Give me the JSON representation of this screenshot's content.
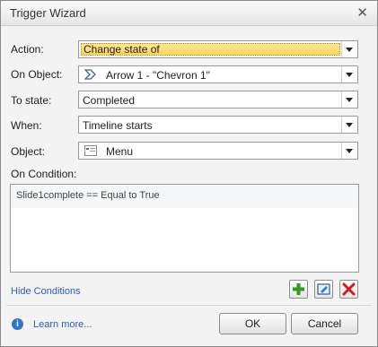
{
  "window": {
    "title": "Trigger Wizard"
  },
  "form": {
    "action": {
      "label": "Action:",
      "value": "Change state of"
    },
    "on_object": {
      "label": "On Object:",
      "value": "Arrow 1 - \"Chevron 1\""
    },
    "to_state": {
      "label": "To state:",
      "value": "Completed"
    },
    "when": {
      "label": "When:",
      "value": "Timeline starts"
    },
    "object": {
      "label": "Object:",
      "value": "Menu"
    }
  },
  "conditions": {
    "label": "On Condition:",
    "items": [
      {
        "text": "Slide1complete == Equal to True"
      }
    ],
    "hide_link": "Hide Conditions"
  },
  "footer": {
    "learn_more": "Learn more...",
    "ok": "OK",
    "cancel": "Cancel"
  },
  "colors": {
    "highlight": "#ffd65c",
    "link": "#2a5cb8",
    "add_green": "#2e9b1d",
    "delete_red": "#d01c1c"
  }
}
